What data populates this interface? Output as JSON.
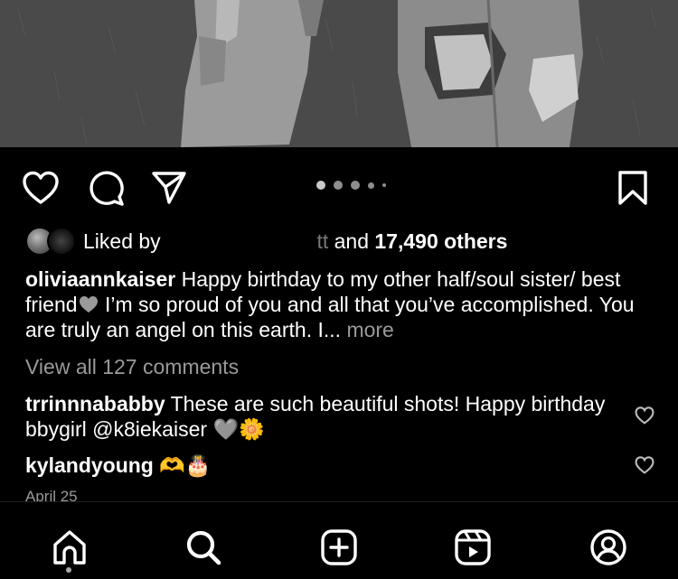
{
  "post": {
    "dots_count": 5,
    "active_dot_index": 0,
    "liked": {
      "prefix": "Liked by",
      "redacted_fragment": "tt",
      "and_text": "and",
      "count_text": "17,490 others"
    },
    "caption": {
      "username": "oliviaannkaiser",
      "text_part1": "Happy birthday to my other half/soul sister/ best friend",
      "text_part2": "I’m so proud of you and all that you’ve accomplished. You are truly an angel on this earth. I...",
      "more_label": "more"
    },
    "view_all_comments": "View all 127 comments",
    "comments": [
      {
        "username": "trrinnnababby",
        "text": "These are such beautiful shots! Happy birthday bbygirl @k8iekaiser",
        "emoji": "🩶🌼"
      },
      {
        "username": "kylandyoung",
        "text": "",
        "emoji": "🫶🎂"
      }
    ],
    "date": "April 25"
  },
  "icons": {
    "like": "heart-icon",
    "comment": "comment-icon",
    "share": "send-icon",
    "save": "bookmark-icon"
  },
  "tabbar": {
    "items": [
      {
        "name": "home",
        "icon": "home-icon",
        "active": true
      },
      {
        "name": "search",
        "icon": "search-icon",
        "active": false
      },
      {
        "name": "create",
        "icon": "plus-square-icon",
        "active": false
      },
      {
        "name": "reels",
        "icon": "reels-icon",
        "active": false
      },
      {
        "name": "profile",
        "icon": "profile-icon",
        "active": false
      }
    ]
  }
}
